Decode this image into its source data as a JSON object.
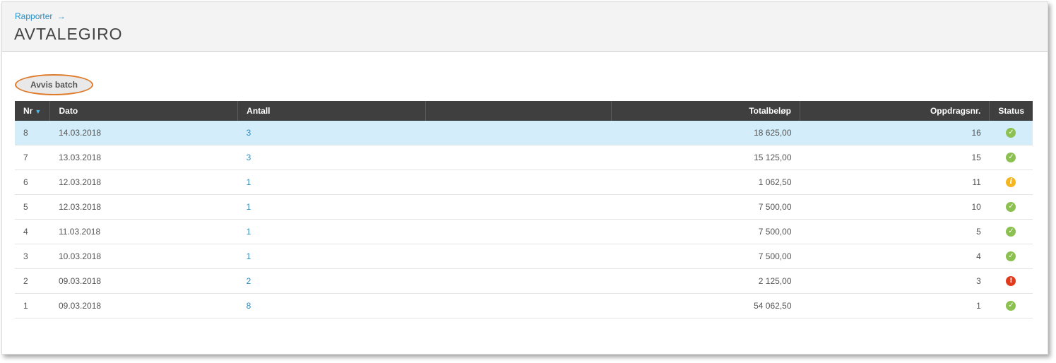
{
  "header": {
    "breadcrumb": "Rapporter",
    "breadcrumb_arrow": "→",
    "title": "AVTALEGIRO"
  },
  "actions": {
    "reject_batch_label": "Avvis batch"
  },
  "table": {
    "columns": {
      "nr": "Nr",
      "dato": "Dato",
      "antall": "Antall",
      "blank": "",
      "totalbelop": "Totalbeløp",
      "oppdragsnr": "Oppdragsnr.",
      "status": "Status"
    },
    "sort_icon": "▼",
    "rows": [
      {
        "nr": "8",
        "dato": "14.03.2018",
        "antall": "3",
        "total": "18 625,00",
        "oppdrag": "16",
        "status": "ok",
        "selected": true
      },
      {
        "nr": "7",
        "dato": "13.03.2018",
        "antall": "3",
        "total": "15 125,00",
        "oppdrag": "15",
        "status": "ok"
      },
      {
        "nr": "6",
        "dato": "12.03.2018",
        "antall": "1",
        "total": "1 062,50",
        "oppdrag": "11",
        "status": "info"
      },
      {
        "nr": "5",
        "dato": "12.03.2018",
        "antall": "1",
        "total": "7 500,00",
        "oppdrag": "10",
        "status": "ok"
      },
      {
        "nr": "4",
        "dato": "11.03.2018",
        "antall": "1",
        "total": "7 500,00",
        "oppdrag": "5",
        "status": "ok"
      },
      {
        "nr": "3",
        "dato": "10.03.2018",
        "antall": "1",
        "total": "7 500,00",
        "oppdrag": "4",
        "status": "ok"
      },
      {
        "nr": "2",
        "dato": "09.03.2018",
        "antall": "2",
        "total": "2 125,00",
        "oppdrag": "3",
        "status": "error"
      },
      {
        "nr": "1",
        "dato": "09.03.2018",
        "antall": "8",
        "total": "54 062,50",
        "oppdrag": "1",
        "status": "ok"
      }
    ]
  },
  "status_icons": {
    "ok": {
      "name": "check-circle-icon",
      "glyph": "✓",
      "color": "#8cc152"
    },
    "info": {
      "name": "info-circle-icon",
      "glyph": "i",
      "color": "#f5b51e"
    },
    "error": {
      "name": "exclamation-circle-icon",
      "glyph": "!",
      "color": "#e23a1c"
    }
  },
  "colors": {
    "accent": "#2a8fc4",
    "header_bg": "#3f3f3f",
    "selected_row": "#d3eefa",
    "highlight_ring": "#e07b2a"
  }
}
